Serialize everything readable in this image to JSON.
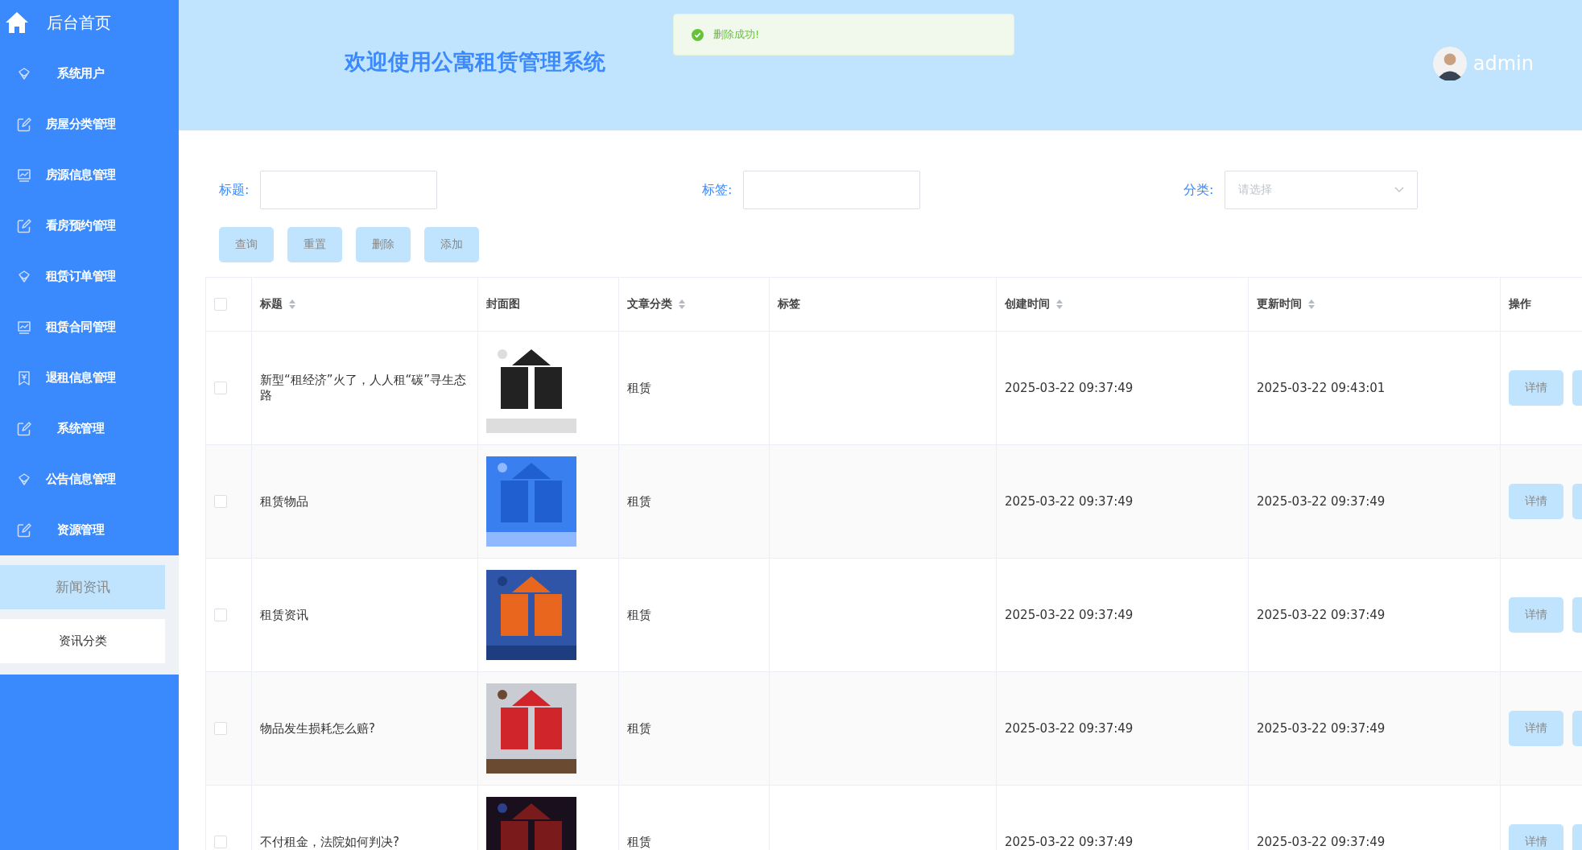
{
  "sidebar": {
    "home": "后台首页",
    "items": [
      {
        "label": "系统用户",
        "kind": "diamond"
      },
      {
        "label": "房屋分类管理",
        "kind": "edit"
      },
      {
        "label": "房源信息管理",
        "kind": "chart"
      },
      {
        "label": "看房预约管理",
        "kind": "edit"
      },
      {
        "label": "租赁订单管理",
        "kind": "diamond"
      },
      {
        "label": "租赁合同管理",
        "kind": "chart"
      },
      {
        "label": "退租信息管理",
        "kind": "ticket"
      },
      {
        "label": "系统管理",
        "kind": "edit"
      },
      {
        "label": "公告信息管理",
        "kind": "diamond"
      },
      {
        "label": "资源管理",
        "kind": "edit"
      }
    ],
    "subitems": [
      {
        "label": "新闻资讯",
        "selected": true
      },
      {
        "label": "资讯分类",
        "selected": false
      }
    ]
  },
  "header": {
    "title": "欢迎使用公寓租赁管理系统",
    "user": "admin"
  },
  "toast": {
    "message": "删除成功!"
  },
  "filters": [
    {
      "label": "标题:",
      "kind": "input"
    },
    {
      "label": "标签:",
      "kind": "input"
    },
    {
      "label": "分类:",
      "kind": "select",
      "placeholder": "请选择"
    }
  ],
  "buttons": [
    "查询",
    "重置",
    "删除",
    "添加"
  ],
  "table": {
    "all_checked": false,
    "columns": [
      {
        "label": "标题",
        "sortable": true
      },
      {
        "label": "封面图",
        "sortable": false
      },
      {
        "label": "文章分类",
        "sortable": true
      },
      {
        "label": "标签",
        "sortable": false
      },
      {
        "label": "创建时间",
        "sortable": true
      },
      {
        "label": "更新时间",
        "sortable": true
      },
      {
        "label": "操作",
        "sortable": false
      }
    ],
    "rows": [
      {
        "checked": false,
        "title": "新型“租经济”火了，人人租“碳”寻生态路",
        "category": "租赁",
        "created": "2025-03-22 09:37:49",
        "updated": "2025-03-22 09:43:01",
        "action": "详情"
      },
      {
        "checked": false,
        "title": "租赁物品",
        "category": "租赁",
        "created": "2025-03-22 09:37:49",
        "updated": "2025-03-22 09:37:49",
        "action": "详情"
      },
      {
        "checked": false,
        "title": "租赁资讯",
        "category": "租赁",
        "created": "2025-03-22 09:37:49",
        "updated": "2025-03-22 09:37:49",
        "action": "详情"
      },
      {
        "checked": false,
        "title": "物品发生损耗怎么赔?",
        "category": "租赁",
        "created": "2025-03-22 09:37:49",
        "updated": "2025-03-22 09:37:49",
        "action": "详情"
      },
      {
        "checked": false,
        "title": "不付租金，法院如何判决?",
        "category": "租赁",
        "created": "2025-03-22 09:37:49",
        "updated": "2025-03-22 09:37:49",
        "action": "详情"
      }
    ]
  }
}
